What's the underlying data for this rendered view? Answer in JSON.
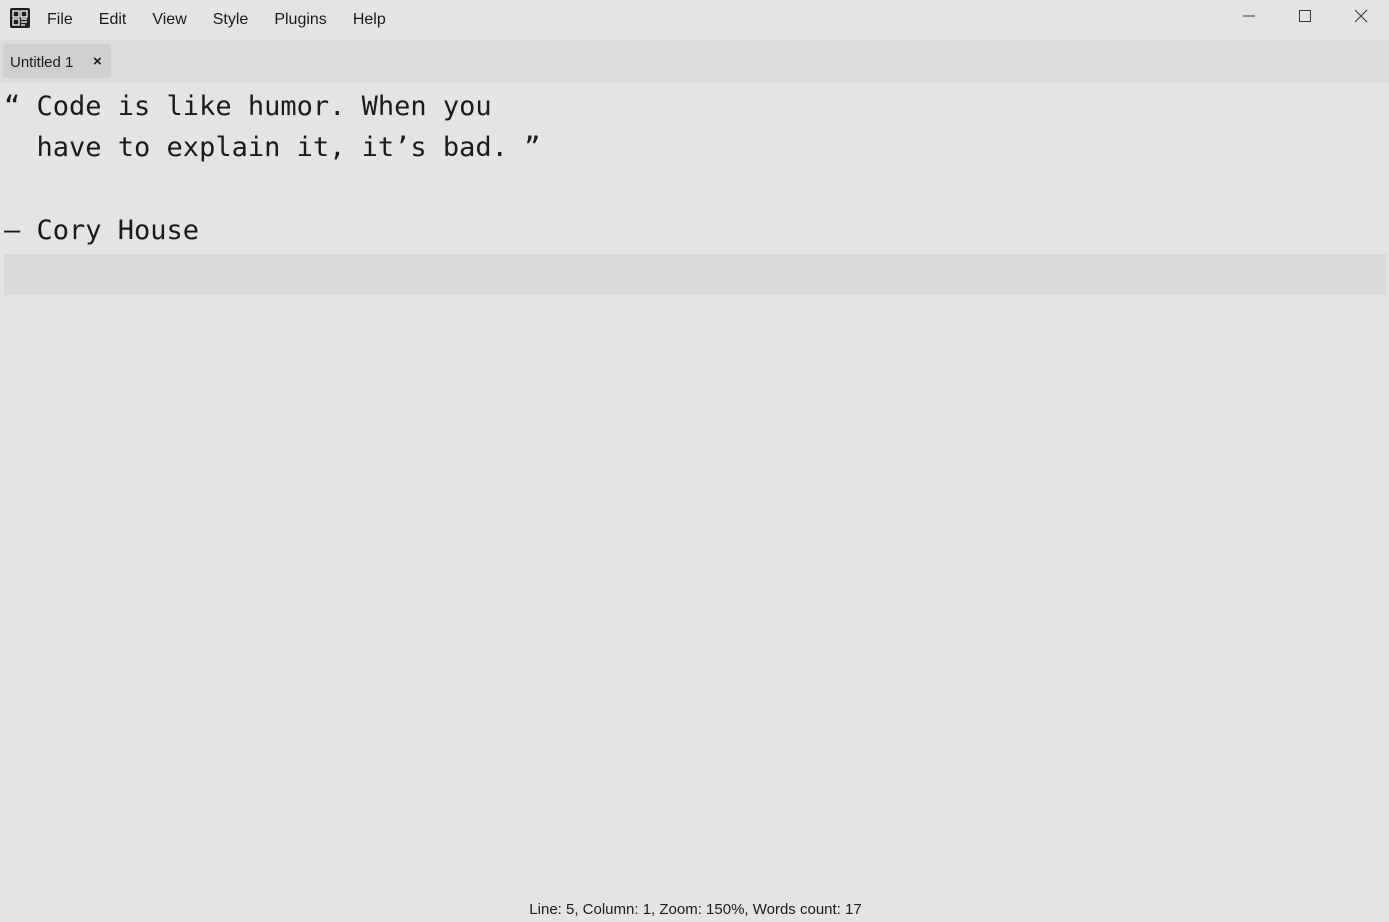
{
  "menu": {
    "items": [
      "File",
      "Edit",
      "View",
      "Style",
      "Plugins",
      "Help"
    ]
  },
  "window_controls": {
    "minimize_icon": "minimize-icon",
    "maximize_icon": "maximize-icon",
    "close_icon": "close-icon"
  },
  "tabs": [
    {
      "label": "Untitled 1",
      "close_label": "×"
    }
  ],
  "editor": {
    "lines": [
      "“ Code is like humor. When you",
      "  have to explain it, it’s bad. ”",
      "",
      "– Cory House",
      ""
    ]
  },
  "status": {
    "text": "Line: 5, Column: 1, Zoom: 150%, Words count: 17"
  },
  "colors": {
    "background": "#e4e4e4",
    "tabbar": "#dcdcdc",
    "active_tab": "#cfcfcf",
    "current_line": "#dadada",
    "text": "#1a1a1a"
  }
}
